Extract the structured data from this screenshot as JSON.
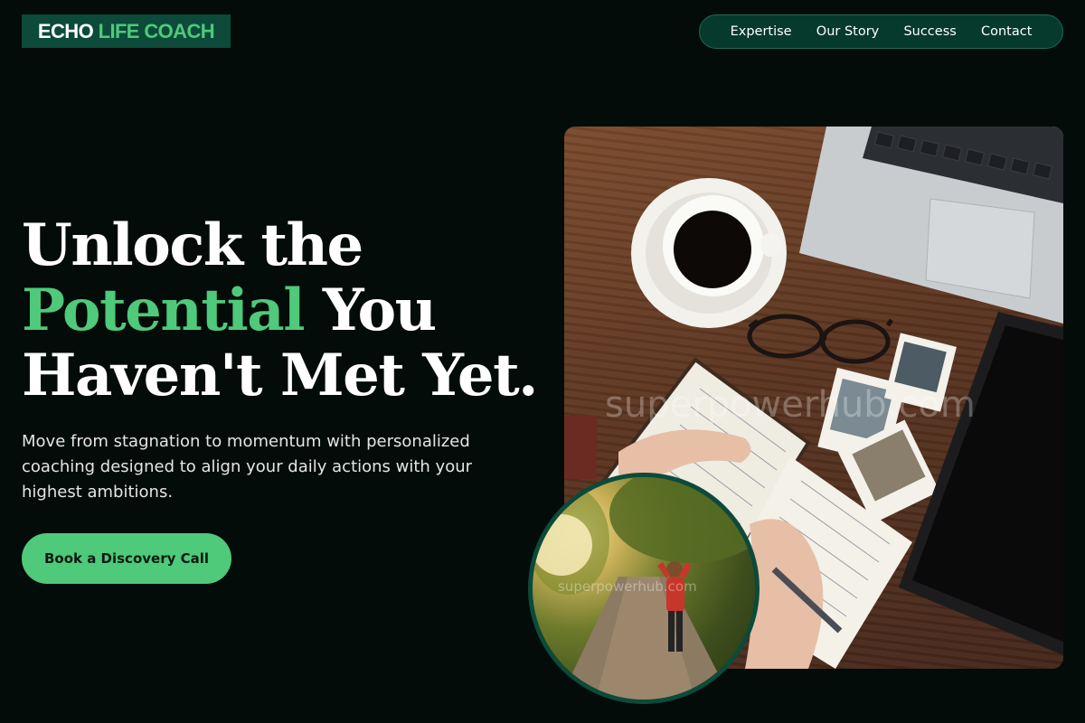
{
  "header": {
    "logo": {
      "word1": "ECHO",
      "word2": "LIFE COACH"
    },
    "nav": [
      {
        "label": "Expertise"
      },
      {
        "label": "Our Story"
      },
      {
        "label": "Success"
      },
      {
        "label": "Contact"
      }
    ]
  },
  "hero": {
    "headline_line1": "Unlock the",
    "headline_accent": "Potential",
    "headline_line2_rest": " You",
    "headline_line3": "Haven't Met Yet.",
    "subtext": "Move from stagnation to momentum with personalized coaching designed to align your daily actions with your highest ambitions.",
    "cta_label": "Book a Discovery Call"
  },
  "images": {
    "main_photo_watermark": "superpowerhub.com",
    "circle_photo_watermark": "superpowerhub.com"
  },
  "colors": {
    "background": "#040c09",
    "accent_green": "#4fc97a",
    "brand_dark_green": "#0c4a3a",
    "nav_bg": "#053a2c"
  }
}
